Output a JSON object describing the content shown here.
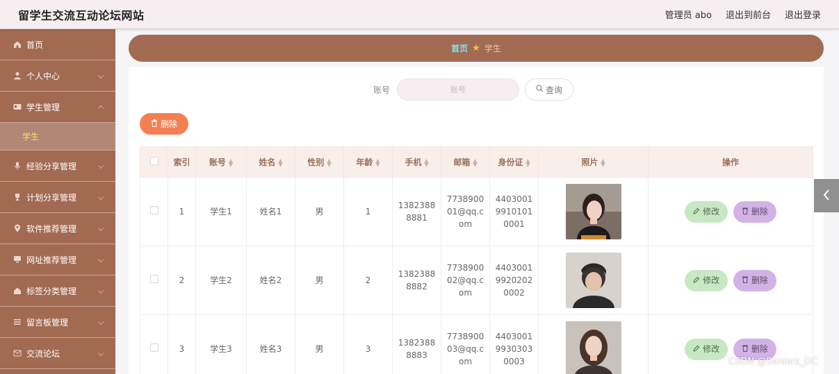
{
  "header": {
    "title": "留学生交流互动论坛网站",
    "user_label": "管理员 abo",
    "to_front": "退出到前台",
    "logout": "退出登录"
  },
  "sidebar": {
    "items": [
      {
        "label": "首页",
        "icon": "home-icon"
      },
      {
        "label": "个人中心",
        "icon": "user-icon"
      },
      {
        "label": "学生管理",
        "icon": "id-card-icon",
        "expanded": true
      },
      {
        "label": "学生",
        "sub": true
      },
      {
        "label": "经验分享管理",
        "icon": "mic-icon"
      },
      {
        "label": "计划分享管理",
        "icon": "trophy-icon"
      },
      {
        "label": "软件推荐管理",
        "icon": "location-icon"
      },
      {
        "label": "网址推荐管理",
        "icon": "monitor-icon"
      },
      {
        "label": "标签分类管理",
        "icon": "home-icon"
      },
      {
        "label": "留言板管理",
        "icon": "list-icon"
      },
      {
        "label": "交流论坛",
        "icon": "mail-icon"
      }
    ]
  },
  "breadcrumb": {
    "home": "首页",
    "current": "学生"
  },
  "search": {
    "label": "账号",
    "placeholder": "账号",
    "button": "查询"
  },
  "actions": {
    "delete": "删除"
  },
  "table": {
    "headers": [
      "索引",
      "账号",
      "姓名",
      "性别",
      "年龄",
      "手机",
      "邮箱",
      "身份证",
      "照片",
      "操作"
    ],
    "rows": [
      {
        "index": "1",
        "account": "学生1",
        "name": "姓名1",
        "gender": "男",
        "age": "1",
        "phone": "13823888881",
        "email": "773890001@qq.com",
        "id_card": "440300199101010001"
      },
      {
        "index": "2",
        "account": "学生2",
        "name": "姓名2",
        "gender": "男",
        "age": "2",
        "phone": "13823888882",
        "email": "773890002@qq.com",
        "id_card": "440300199202020002"
      },
      {
        "index": "3",
        "account": "学生3",
        "name": "姓名3",
        "gender": "男",
        "age": "3",
        "phone": "13823888883",
        "email": "773890003@qq.com",
        "id_card": "440300199303030003"
      }
    ],
    "edit_label": "修改",
    "delete_label": "删除"
  },
  "watermark": "CSDN @Seniors_DC",
  "colors": {
    "sidebar": "#a36a52",
    "breadcrumb_home": "#7fe3f0",
    "delete_button": "#f57f53",
    "edit_button": "#c7e8c3",
    "remove_button": "#d3b3e6"
  }
}
